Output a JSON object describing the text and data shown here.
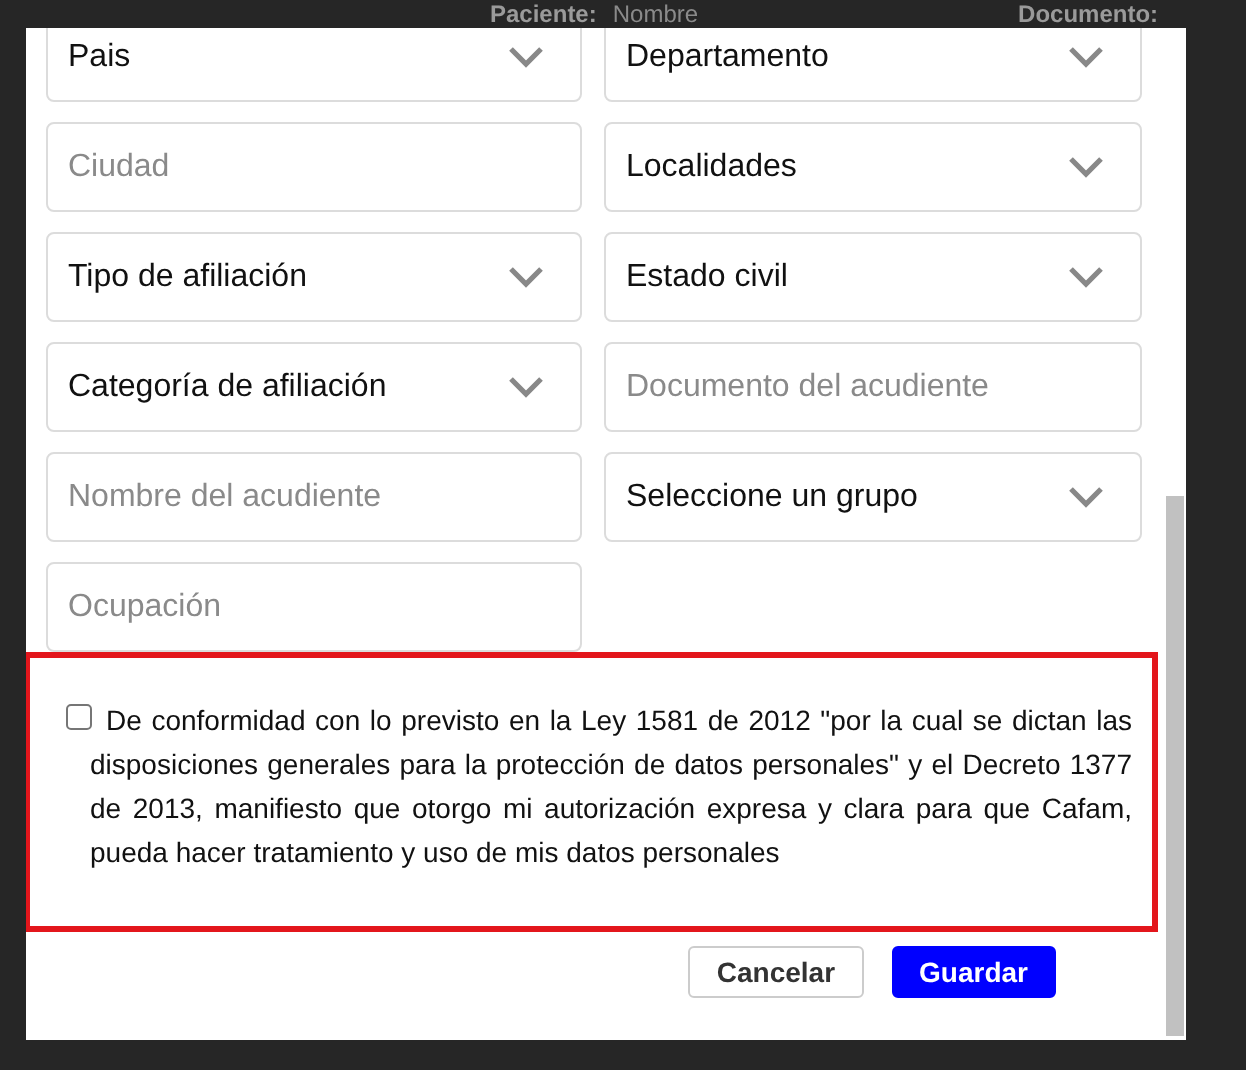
{
  "background": {
    "header": [
      {
        "kind": "label",
        "text": "Paciente:"
      },
      {
        "kind": "value",
        "text": "Nombre"
      },
      {
        "kind": "label",
        "text": "Documento:"
      }
    ]
  },
  "form": {
    "fields": [
      {
        "kind": "select",
        "value": "Pais"
      },
      {
        "kind": "select",
        "value": "Departamento"
      },
      {
        "kind": "input",
        "placeholder": "Ciudad"
      },
      {
        "kind": "select",
        "value": "Localidades"
      },
      {
        "kind": "select",
        "value": "Tipo de afiliación"
      },
      {
        "kind": "select",
        "value": "Estado civil"
      },
      {
        "kind": "select",
        "value": "Categoría de afiliación"
      },
      {
        "kind": "input",
        "placeholder": "Documento del acudiente"
      },
      {
        "kind": "input",
        "placeholder": "Nombre del acudiente"
      },
      {
        "kind": "select",
        "value": "Seleccione un grupo"
      },
      {
        "kind": "input",
        "placeholder": "Ocupación"
      }
    ],
    "consent": {
      "checked": false,
      "text": "De conformidad con lo previsto en la Ley 1581 de 2012 \"por la cual se dictan las disposiciones generales para la protección de datos personales\" y el Decreto 1377 de 2013, manifiesto que otorgo mi autorización expresa y clara para que Cafam, pueda hacer tratamiento y uso de mis datos personales"
    },
    "buttons": [
      {
        "kind": "secondary",
        "label": "Cancelar"
      },
      {
        "kind": "primary",
        "label": "Guardar"
      }
    ]
  }
}
